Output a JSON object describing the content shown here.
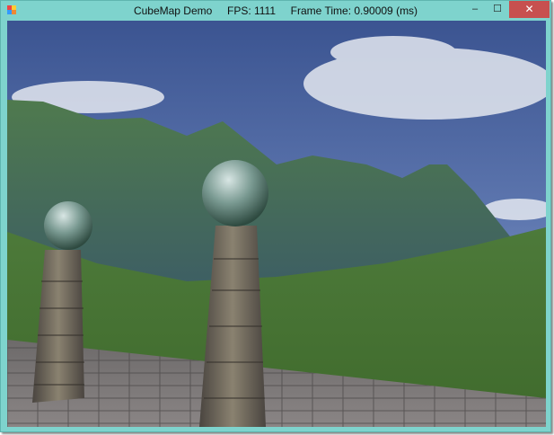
{
  "window": {
    "title": "CubeMap Demo     FPS: 1111     Frame Time: 0.90009 (ms)",
    "minimize_label": "–",
    "maximize_label": "☐",
    "close_label": "✕"
  },
  "colors": {
    "titlebar": "#7ed3cd",
    "close": "#c7504f"
  }
}
